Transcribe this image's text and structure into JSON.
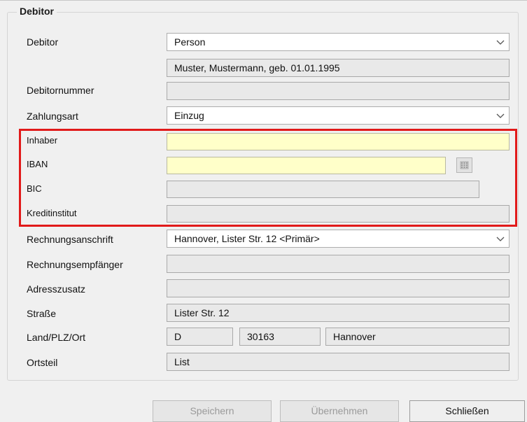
{
  "section": {
    "legend": "Debitor"
  },
  "fields": {
    "debitor": {
      "label": "Debitor",
      "value": "Person",
      "detail": "Muster, Mustermann, geb. 01.01.1995"
    },
    "debitornummer": {
      "label": "Debitornummer",
      "value": ""
    },
    "zahlungsart": {
      "label": "Zahlungsart",
      "value": "Einzug"
    },
    "inhaber": {
      "label": "Inhaber",
      "value": ""
    },
    "iban": {
      "label": "IBAN",
      "value": ""
    },
    "bic": {
      "label": "BIC",
      "value": ""
    },
    "kreditinstitut": {
      "label": "Kreditinstitut",
      "value": ""
    },
    "rechnungsanschrift": {
      "label": "Rechnungsanschrift",
      "value": "Hannover, Lister Str. 12 <Primär>"
    },
    "rechnungsempfaenger": {
      "label": "Rechnungsempfänger",
      "value": ""
    },
    "adresszusatz": {
      "label": "Adresszusatz",
      "value": ""
    },
    "strasse": {
      "label": "Straße",
      "value": "Lister Str. 12"
    },
    "land_plz_ort": {
      "label": "Land/PLZ/Ort",
      "land": "D",
      "plz": "30163",
      "ort": "Hannover"
    },
    "ortsteil": {
      "label": "Ortsteil",
      "value": "List"
    }
  },
  "buttons": {
    "save": "Speichern",
    "apply": "Übernehmen",
    "close": "Schließen"
  },
  "icons": {
    "dropdown": "chevron-down-icon",
    "calendar": "calendar-grid-icon"
  },
  "colors": {
    "highlight": "#e11a1a",
    "required_bg": "#ffffc9"
  }
}
